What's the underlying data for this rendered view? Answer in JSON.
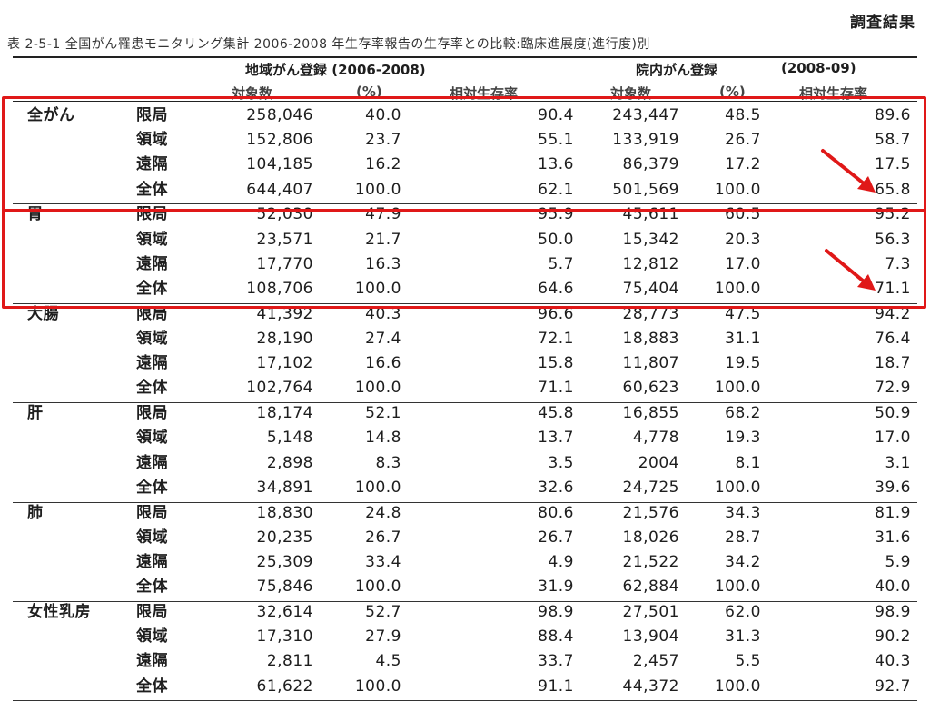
{
  "doc_label": "調査結果",
  "title": "表 2-5-1  全国がん罹患モニタリング集計 2006-2008 年生存率報告の生存率との比較:臨床進展度(進行度)別",
  "group_headers": {
    "regional": "地域がん登録 (2006-2008)",
    "hospital": "院内がん登録",
    "hospital_years": "(2008-09)"
  },
  "column_headers": {
    "count": "対象数",
    "pct": "(%)",
    "survival": "相対生存率",
    "count2": "対象数",
    "pct2": "(%)",
    "survival2": "相対生存率"
  },
  "sites": [
    {
      "name": "全がん",
      "rows": [
        {
          "stage": "限局",
          "count": "258,046",
          "pct": "40.0",
          "survival": "90.4",
          "count2": "243,447",
          "pct2": "48.5",
          "survival2": "89.6"
        },
        {
          "stage": "領域",
          "count": "152,806",
          "pct": "23.7",
          "survival": "55.1",
          "count2": "133,919",
          "pct2": "26.7",
          "survival2": "58.7"
        },
        {
          "stage": "遠隔",
          "count": "104,185",
          "pct": "16.2",
          "survival": "13.6",
          "count2": "86,379",
          "pct2": "17.2",
          "survival2": "17.5"
        },
        {
          "stage": "全体",
          "count": "644,407",
          "pct": "100.0",
          "survival": "62.1",
          "count2": "501,569",
          "pct2": "100.0",
          "survival2": "65.8"
        }
      ]
    },
    {
      "name": "胃",
      "rows": [
        {
          "stage": "限局",
          "count": "52,030",
          "pct": "47.9",
          "survival": "95.9",
          "count2": "45,611",
          "pct2": "60.5",
          "survival2": "95.2"
        },
        {
          "stage": "領域",
          "count": "23,571",
          "pct": "21.7",
          "survival": "50.0",
          "count2": "15,342",
          "pct2": "20.3",
          "survival2": "56.3"
        },
        {
          "stage": "遠隔",
          "count": "17,770",
          "pct": "16.3",
          "survival": "5.7",
          "count2": "12,812",
          "pct2": "17.0",
          "survival2": "7.3"
        },
        {
          "stage": "全体",
          "count": "108,706",
          "pct": "100.0",
          "survival": "64.6",
          "count2": "75,404",
          "pct2": "100.0",
          "survival2": "71.1"
        }
      ]
    },
    {
      "name": "大腸",
      "rows": [
        {
          "stage": "限局",
          "count": "41,392",
          "pct": "40.3",
          "survival": "96.6",
          "count2": "28,773",
          "pct2": "47.5",
          "survival2": "94.2"
        },
        {
          "stage": "領域",
          "count": "28,190",
          "pct": "27.4",
          "survival": "72.1",
          "count2": "18,883",
          "pct2": "31.1",
          "survival2": "76.4"
        },
        {
          "stage": "遠隔",
          "count": "17,102",
          "pct": "16.6",
          "survival": "15.8",
          "count2": "11,807",
          "pct2": "19.5",
          "survival2": "18.7"
        },
        {
          "stage": "全体",
          "count": "102,764",
          "pct": "100.0",
          "survival": "71.1",
          "count2": "60,623",
          "pct2": "100.0",
          "survival2": "72.9"
        }
      ]
    },
    {
      "name": "肝",
      "rows": [
        {
          "stage": "限局",
          "count": "18,174",
          "pct": "52.1",
          "survival": "45.8",
          "count2": "16,855",
          "pct2": "68.2",
          "survival2": "50.9"
        },
        {
          "stage": "領域",
          "count": "5,148",
          "pct": "14.8",
          "survival": "13.7",
          "count2": "4,778",
          "pct2": "19.3",
          "survival2": "17.0"
        },
        {
          "stage": "遠隔",
          "count": "2,898",
          "pct": "8.3",
          "survival": "3.5",
          "count2": "2004",
          "pct2": "8.1",
          "survival2": "3.1"
        },
        {
          "stage": "全体",
          "count": "34,891",
          "pct": "100.0",
          "survival": "32.6",
          "count2": "24,725",
          "pct2": "100.0",
          "survival2": "39.6"
        }
      ]
    },
    {
      "name": "肺",
      "rows": [
        {
          "stage": "限局",
          "count": "18,830",
          "pct": "24.8",
          "survival": "80.6",
          "count2": "21,576",
          "pct2": "34.3",
          "survival2": "81.9"
        },
        {
          "stage": "領域",
          "count": "20,235",
          "pct": "26.7",
          "survival": "26.7",
          "count2": "18,026",
          "pct2": "28.7",
          "survival2": "31.6"
        },
        {
          "stage": "遠隔",
          "count": "25,309",
          "pct": "33.4",
          "survival": "4.9",
          "count2": "21,522",
          "pct2": "34.2",
          "survival2": "5.9"
        },
        {
          "stage": "全体",
          "count": "75,846",
          "pct": "100.0",
          "survival": "31.9",
          "count2": "62,884",
          "pct2": "100.0",
          "survival2": "40.0"
        }
      ]
    },
    {
      "name": "女性乳房",
      "rows": [
        {
          "stage": "限局",
          "count": "32,614",
          "pct": "52.7",
          "survival": "98.9",
          "count2": "27,501",
          "pct2": "62.0",
          "survival2": "98.9"
        },
        {
          "stage": "領域",
          "count": "17,310",
          "pct": "27.9",
          "survival": "88.4",
          "count2": "13,904",
          "pct2": "31.3",
          "survival2": "90.2"
        },
        {
          "stage": "遠隔",
          "count": "2,811",
          "pct": "4.5",
          "survival": "33.7",
          "count2": "2,457",
          "pct2": "5.5",
          "survival2": "40.3"
        },
        {
          "stage": "全体",
          "count": "61,622",
          "pct": "100.0",
          "survival": "91.1",
          "count2": "44,372",
          "pct2": "100.0",
          "survival2": "92.7"
        }
      ]
    }
  ],
  "annotation_color": "#e01818"
}
